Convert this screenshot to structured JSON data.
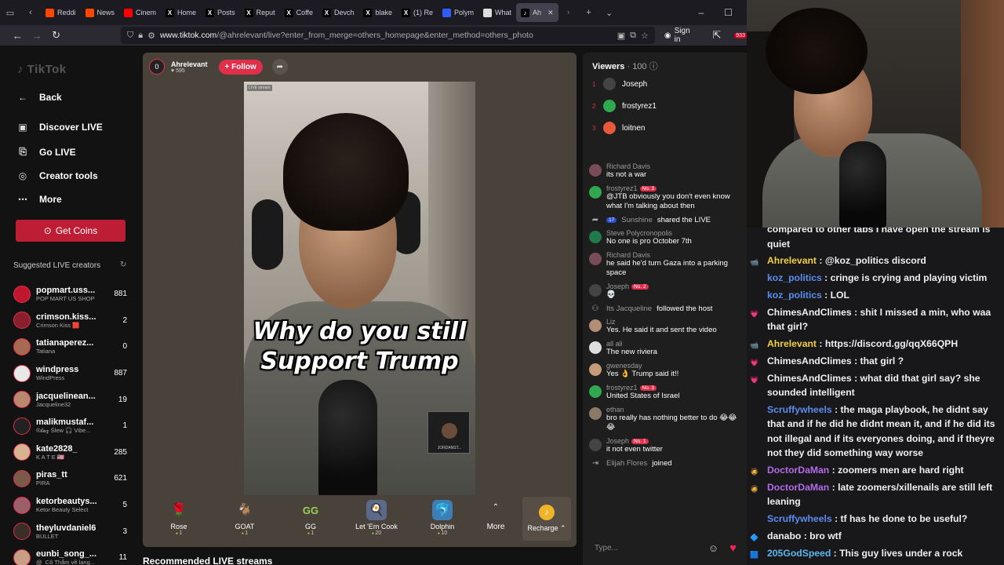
{
  "browser": {
    "tabs": [
      {
        "label": "Reddi",
        "color": "#ff4500",
        "glyph": ""
      },
      {
        "label": "News",
        "color": "#ff4500",
        "glyph": ""
      },
      {
        "label": "Cinem",
        "color": "#ff0000",
        "glyph": ""
      },
      {
        "label": "Home",
        "color": "#000000",
        "glyph": "X"
      },
      {
        "label": "Posts",
        "color": "#000000",
        "glyph": "X"
      },
      {
        "label": "Reput",
        "color": "#000000",
        "glyph": "X"
      },
      {
        "label": "Coffe",
        "color": "#000000",
        "glyph": "X"
      },
      {
        "label": "Devch",
        "color": "#000000",
        "glyph": "X"
      },
      {
        "label": "blake",
        "color": "#000000",
        "glyph": "X"
      },
      {
        "label": "(1) Re",
        "color": "#000000",
        "glyph": "X"
      },
      {
        "label": "Polym",
        "color": "#2e5cff",
        "glyph": ""
      },
      {
        "label": "What",
        "color": "#dddddd",
        "glyph": ""
      },
      {
        "label": "Ah",
        "color": "#000000",
        "glyph": "♪"
      }
    ],
    "url_host": "www.tiktok.com",
    "url_path": "/@ahrelevant/live?enter_from_merge=others_homepage&enter_method=others_photo",
    "sign_in": "Sign in",
    "notif_count": "933"
  },
  "tiktok": {
    "logo": "TikTok",
    "nav": [
      {
        "label": "Back",
        "icon": "arrow-left-icon"
      },
      {
        "label": "Discover LIVE",
        "icon": "live-tv-icon"
      },
      {
        "label": "Go LIVE",
        "icon": "camera-icon"
      },
      {
        "label": "Creator tools",
        "icon": "lightbulb-icon"
      },
      {
        "label": "More",
        "icon": "more-dots-icon"
      }
    ],
    "get_coins": "Get Coins",
    "suggested_title": "Suggested LIVE creators",
    "suggested": [
      {
        "user": "popmart.uss...",
        "sub": "POP MART US SHOP",
        "count": "881",
        "color": "#c0172e"
      },
      {
        "user": "crimson.kiss...",
        "sub": "Crimson Kiss 🟥",
        "count": "2",
        "color": "#8a1f2b"
      },
      {
        "user": "tatianaperez...",
        "sub": "Tatiana",
        "count": "0",
        "color": "#a56a4f"
      },
      {
        "user": "windpress",
        "sub": "WindPress",
        "count": "887",
        "color": "#e8e8e8"
      },
      {
        "user": "jacquelinean...",
        "sub": "Jacqueline32",
        "count": "19",
        "color": "#b9886e"
      },
      {
        "user": "malikmustaf...",
        "sub": "®𝓵𝓪𝔃 Ślew 🎧 Vibe...",
        "count": "1",
        "color": "#222222"
      },
      {
        "user": "kate2828_",
        "sub": "K A T E 🇺🇸",
        "count": "285",
        "color": "#d8b38f"
      },
      {
        "user": "piras_tt",
        "sub": "PIRA",
        "count": "621",
        "color": "#7b5a4a"
      },
      {
        "user": "ketorbeautys...",
        "sub": "Ketor Beauty Select",
        "count": "5",
        "color": "#9c5f6a"
      },
      {
        "user": "theyluvdaniel6",
        "sub": "BULLET",
        "count": "3",
        "color": "#3b2d27"
      },
      {
        "user": "eunbi_song_...",
        "sub": "@_Cô Thắm về lang...",
        "count": "11",
        "color": "#c79e86"
      }
    ],
    "host": {
      "name": "Ahrelevant",
      "likes": "595",
      "follow": "+ Follow",
      "avatar_glyph": "0"
    },
    "video": {
      "caption_line1": "Why do you  still",
      "caption_line2": "Support Trump",
      "live_tag": "LIVE stream",
      "pip_label": "JORDANST..."
    },
    "gifts": [
      {
        "name": "Rose",
        "price": "1",
        "glyph": "🌹",
        "bg": "transparent"
      },
      {
        "name": "GOAT",
        "price": "1",
        "glyph": "🐐",
        "bg": "transparent"
      },
      {
        "name": "GG",
        "price": "1",
        "glyph": "GG",
        "bg": "transparent"
      },
      {
        "name": "Let 'Em Cook",
        "price": "20",
        "glyph": "🍳",
        "bg": "#5b6a8a"
      },
      {
        "name": "Dolphin",
        "price": "10",
        "glyph": "🐬",
        "bg": "#3b7fb6"
      }
    ],
    "more": "More",
    "recharge": "Recharge",
    "recommended": "Recommended LIVE streams"
  },
  "panel": {
    "viewers_label": "Viewers",
    "viewers_count": "100",
    "top_viewers": [
      {
        "rank": "1",
        "name": "Joseph",
        "color": "#444444"
      },
      {
        "rank": "2",
        "name": "frostyrez1",
        "color": "#2fa84f"
      },
      {
        "rank": "3",
        "name": "loitnen",
        "color": "#e8583a"
      }
    ],
    "messages": [
      {
        "type": "msg",
        "user": "Richard Davis",
        "rank": "",
        "text": "its not a war",
        "color": "#7a4c5a"
      },
      {
        "type": "msg",
        "user": "frostyrez1",
        "rank": "No. 3",
        "text": "@JTB obviously you don't even know what I'm talking about then",
        "color": "#2fa84f"
      },
      {
        "type": "sys",
        "user": "Sunshine",
        "level": "17",
        "text": "shared the LIVE",
        "icon": "share-icon"
      },
      {
        "type": "msg",
        "user": "Steve Polycronopolis",
        "rank": "",
        "text": "No one is pro October 7th",
        "color": "#1f7a4a"
      },
      {
        "type": "msg",
        "user": "Richard Davis",
        "rank": "",
        "text": "he said he'd turn Gaza into a parking space",
        "color": "#7a4c5a"
      },
      {
        "type": "msg",
        "user": "Joseph",
        "rank": "No. 2",
        "text": "💀",
        "color": "#444444"
      },
      {
        "type": "sys",
        "user": "Its Jacqueline",
        "level": "",
        "text": "followed the host",
        "icon": "user-plus-icon"
      },
      {
        "type": "msg",
        "user": "Liz",
        "rank": "",
        "text": "Yes. He said it and sent the video",
        "color": "#b38e75"
      },
      {
        "type": "msg",
        "user": "all ali",
        "rank": "",
        "text": "The new riviera",
        "color": "#dddddd"
      },
      {
        "type": "msg",
        "user": "gwenesday",
        "rank": "",
        "text": "Yes 👌 Trump said it!!",
        "color": "#c59b78"
      },
      {
        "type": "msg",
        "user": "frostyrez1",
        "rank": "No. 3",
        "text": "United States of Israel",
        "color": "#2fa84f"
      },
      {
        "type": "msg",
        "user": "ethan",
        "rank": "",
        "text": "bro really has nothing better to do 😂😂😂",
        "color": "#8c7a68"
      },
      {
        "type": "msg",
        "user": "Joseph",
        "rank": "No. 1",
        "text": "it not even twitter",
        "color": "#444444"
      },
      {
        "type": "sys",
        "user": "Elijah Flores",
        "level": "",
        "text": "joined",
        "icon": "join-icon"
      }
    ],
    "input_placeholder": "Type..."
  },
  "stream_chat": [
    {
      "user": "",
      "text": "compared to other tabs I have open the stream is quiet",
      "color": "#efeff1",
      "icon": ""
    },
    {
      "user": "Ahrelevant",
      "text": ": @koz_politics discord",
      "color": "#f4d03f",
      "icon": "📹"
    },
    {
      "user": "koz_politics",
      "text": ": cringe is crying and playing victim",
      "color": "#5b8def",
      "icon": ""
    },
    {
      "user": "koz_politics",
      "text": ": LOL",
      "color": "#5b8def",
      "icon": ""
    },
    {
      "user": "ChimesAndClimes",
      "text": ": shit I missed a min, who waa that girl?",
      "color": "#efeff1",
      "icon": "💗"
    },
    {
      "user": "Ahrelevant",
      "text": ": https://discord.gg/qqX66QPH",
      "color": "#f4d03f",
      "icon": "📹"
    },
    {
      "user": "ChimesAndClimes",
      "text": ": that girl ?",
      "color": "#efeff1",
      "icon": "💗"
    },
    {
      "user": "ChimesAndClimes",
      "text": ": what did that girl say? she sounded intelligent",
      "color": "#efeff1",
      "icon": "💗"
    },
    {
      "user": "Scruffywheels",
      "text": ": the maga playbook, he didnt say that and if he did he didnt mean it, and if he did its not illegal and if its everyones doing, and if theyre not they did something way worse",
      "color": "#5b8def",
      "icon": ""
    },
    {
      "user": "DoctorDaMan",
      "text": ": zoomers men are hard right",
      "color": "#b46ae8",
      "icon": "🧔"
    },
    {
      "user": "DoctorDaMan",
      "text": ": late zoomers/xillenails are still left leaning",
      "color": "#b46ae8",
      "icon": "🧔"
    },
    {
      "user": "Scruffywheels",
      "text": ": tf has he done to be useful?",
      "color": "#5b8def",
      "icon": ""
    },
    {
      "user": "danabo",
      "text": ": bro wtf",
      "color": "#efeff1",
      "icon": "🔷"
    },
    {
      "user": "205GodSpeed",
      "text": ": This guy lives under a rock",
      "color": "#5bb8ef",
      "icon": "🟦"
    }
  ]
}
